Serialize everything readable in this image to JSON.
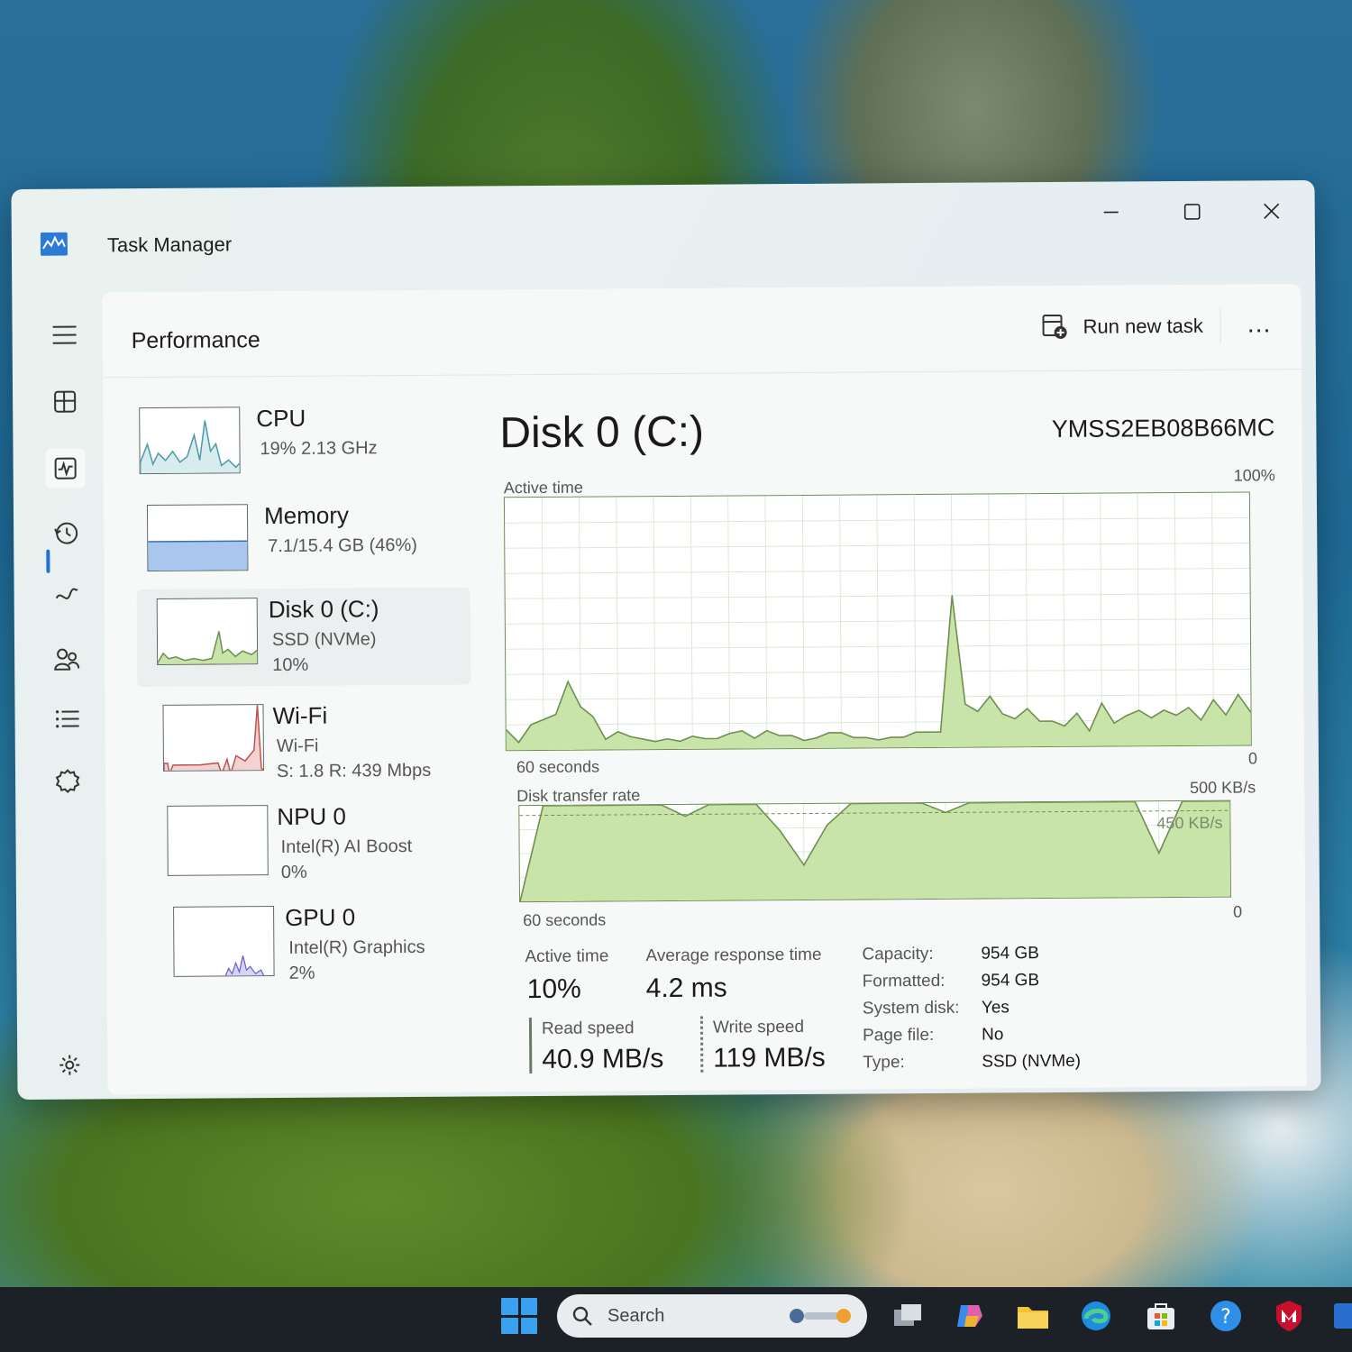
{
  "window": {
    "title": "Task Manager"
  },
  "header": {
    "page_title": "Performance",
    "run_new_task": "Run new task",
    "more": "…"
  },
  "devices": [
    {
      "name": "CPU",
      "sub": "19%  2.13 GHz",
      "sub2": ""
    },
    {
      "name": "Memory",
      "sub": "7.1/15.4 GB (46%)",
      "sub2": ""
    },
    {
      "name": "Disk 0 (C:)",
      "sub": "SSD (NVMe)",
      "sub2": "10%"
    },
    {
      "name": "Wi-Fi",
      "sub": "Wi-Fi",
      "sub2": "S: 1.8  R: 439 Mbps"
    },
    {
      "name": "NPU 0",
      "sub": "Intel(R) AI Boost",
      "sub2": "0%"
    },
    {
      "name": "GPU 0",
      "sub": "Intel(R) Graphics",
      "sub2": "2%"
    }
  ],
  "detail": {
    "title": "Disk 0 (C:)",
    "model": "YMSS2EB08B66MC",
    "active_chart": {
      "label": "Active time",
      "max_label": "100%",
      "time_label": "60 seconds",
      "min_label": "0"
    },
    "transfer_chart": {
      "label": "Disk transfer rate",
      "max_label": "500 KB/s",
      "ref_label": "450 KB/s",
      "time_label": "60 seconds",
      "min_label": "0"
    },
    "stats": {
      "active_time_label": "Active time",
      "active_time_value": "10%",
      "avg_response_label": "Average response time",
      "avg_response_value": "4.2 ms",
      "read_label": "Read speed",
      "read_value": "40.9 MB/s",
      "write_label": "Write speed",
      "write_value": "119 MB/s"
    },
    "properties": [
      {
        "key": "Capacity:",
        "value": "954 GB"
      },
      {
        "key": "Formatted:",
        "value": "954 GB"
      },
      {
        "key": "System disk:",
        "value": "Yes"
      },
      {
        "key": "Page file:",
        "value": "No"
      },
      {
        "key": "Type:",
        "value": "SSD (NVMe)"
      }
    ]
  },
  "taskbar": {
    "search_label": "Search"
  },
  "colors": {
    "disk_fill": "#c9e4a8",
    "disk_line": "#6e8e52",
    "cpu_line": "#4a9aa8",
    "memory_fill": "#a9c6ec",
    "wifi_line": "#c0504d",
    "gpu_line": "#6a5acd",
    "accent": "#1e6fd9"
  },
  "chart_data": [
    {
      "type": "area",
      "title": "Active time",
      "xlabel": "60 seconds",
      "ylim": [
        0,
        100
      ],
      "x": [
        0,
        1,
        2,
        3,
        4,
        5,
        6,
        7,
        8,
        9,
        10,
        11,
        12,
        13,
        14,
        15,
        16,
        17,
        18,
        19,
        20,
        21,
        22,
        23,
        24,
        25,
        26,
        27,
        28,
        29,
        30,
        31,
        32,
        33,
        34,
        35,
        36,
        37,
        38,
        39,
        40,
        41,
        42,
        43,
        44,
        45,
        46,
        47,
        48,
        49,
        50,
        51,
        52,
        53,
        54,
        55,
        56,
        57,
        58,
        59,
        60
      ],
      "values": [
        8,
        3,
        10,
        12,
        14,
        27,
        17,
        13,
        4,
        7,
        5,
        4,
        3,
        4,
        3,
        5,
        4,
        4,
        6,
        7,
        4,
        7,
        5,
        5,
        3,
        4,
        6,
        6,
        4,
        4,
        3,
        4,
        4,
        6,
        6,
        6,
        60,
        17,
        14,
        20,
        13,
        11,
        15,
        10,
        10,
        8,
        13,
        6,
        17,
        9,
        12,
        14,
        11,
        14,
        12,
        15,
        10,
        18,
        12,
        20,
        13
      ],
      "series": [
        {
          "name": "Active time",
          "values": [
            8,
            3,
            10,
            12,
            14,
            27,
            17,
            13,
            4,
            7,
            5,
            4,
            3,
            4,
            3,
            5,
            4,
            4,
            6,
            7,
            4,
            7,
            5,
            5,
            3,
            4,
            6,
            6,
            4,
            4,
            3,
            4,
            4,
            6,
            6,
            6,
            60,
            17,
            14,
            20,
            13,
            11,
            15,
            10,
            10,
            8,
            13,
            6,
            17,
            9,
            12,
            14,
            11,
            14,
            12,
            15,
            10,
            18,
            12,
            20,
            13
          ]
        }
      ]
    },
    {
      "type": "area",
      "title": "Disk transfer rate",
      "xlabel": "60 seconds",
      "ylim": [
        0,
        500
      ],
      "reference_line": 450,
      "x": [
        0,
        2,
        4,
        6,
        8,
        10,
        12,
        14,
        16,
        18,
        20,
        22,
        24,
        26,
        28,
        30,
        32,
        34,
        36,
        38,
        40,
        42,
        44,
        46,
        48,
        50,
        52,
        54,
        56,
        58,
        60
      ],
      "values": [
        0,
        500,
        500,
        500,
        500,
        500,
        500,
        440,
        500,
        500,
        500,
        360,
        180,
        390,
        500,
        500,
        500,
        500,
        450,
        500,
        500,
        500,
        500,
        500,
        500,
        500,
        500,
        230,
        500,
        500,
        500
      ]
    }
  ]
}
